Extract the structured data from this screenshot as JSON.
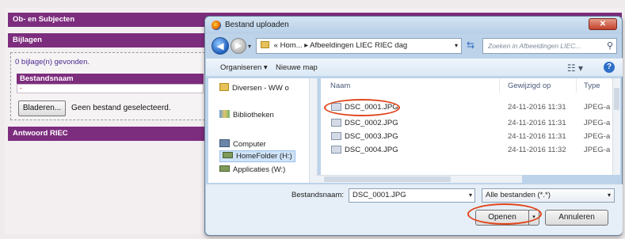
{
  "form": {
    "ob_subjecten": "Ob- en Subjecten",
    "bijlagen": "Bijlagen",
    "found_text": "0 bijlage(n) gevonden.",
    "bestandsnaam_header": "Bestandsnaam",
    "bestand_row": "-",
    "browse_button": "Bladeren...",
    "no_file_text": "Geen bestand geselecteerd.",
    "antwoord": "Antwoord RIEC",
    "accent_color": "#7d2d7e"
  },
  "dialog": {
    "title": "Bestand uploaden",
    "close_label": "✕",
    "address": {
      "prefix": "«",
      "crumb1": "Hom...",
      "separator": "▸",
      "crumb2": "Afbeeldingen LIEC RIEC dag"
    },
    "search_placeholder": "Zoeken in Afbeeldingen LIEC...",
    "toolbar": {
      "organize": "Organiseren ▾",
      "new_folder": "Nieuwe map"
    },
    "nav": [
      {
        "label": "Diversen - WW o",
        "icon": "folder-icon"
      },
      {
        "label": "Bibliotheken",
        "icon": "library-icon"
      },
      {
        "label": "Computer",
        "icon": "computer-icon"
      },
      {
        "label": "HomeFolder (H:)",
        "icon": "drive-icon"
      },
      {
        "label": "Applicaties (W:)",
        "icon": "drive-icon"
      }
    ],
    "columns": {
      "name": "Naam",
      "date": "Gewijzigd op",
      "type": "Type"
    },
    "files": [
      {
        "name": "DSC_0001.JPG",
        "date": "24-11-2016 11:31",
        "type": "JPEG-a"
      },
      {
        "name": "DSC_0002.JPG",
        "date": "24-11-2016 11:31",
        "type": "JPEG-a"
      },
      {
        "name": "DSC_0003.JPG",
        "date": "24-11-2016 11:31",
        "type": "JPEG-a"
      },
      {
        "name": "DSC_0004.JPG",
        "date": "24-11-2016 11:32",
        "type": "JPEG-a"
      }
    ],
    "filename_label": "Bestandsnaam:",
    "filename_value": "DSC_0001.JPG",
    "filter_value": "Alle bestanden (*.*)",
    "open_button": "Openen",
    "cancel_button": "Annuleren",
    "annotation_color": "#e0441a"
  }
}
